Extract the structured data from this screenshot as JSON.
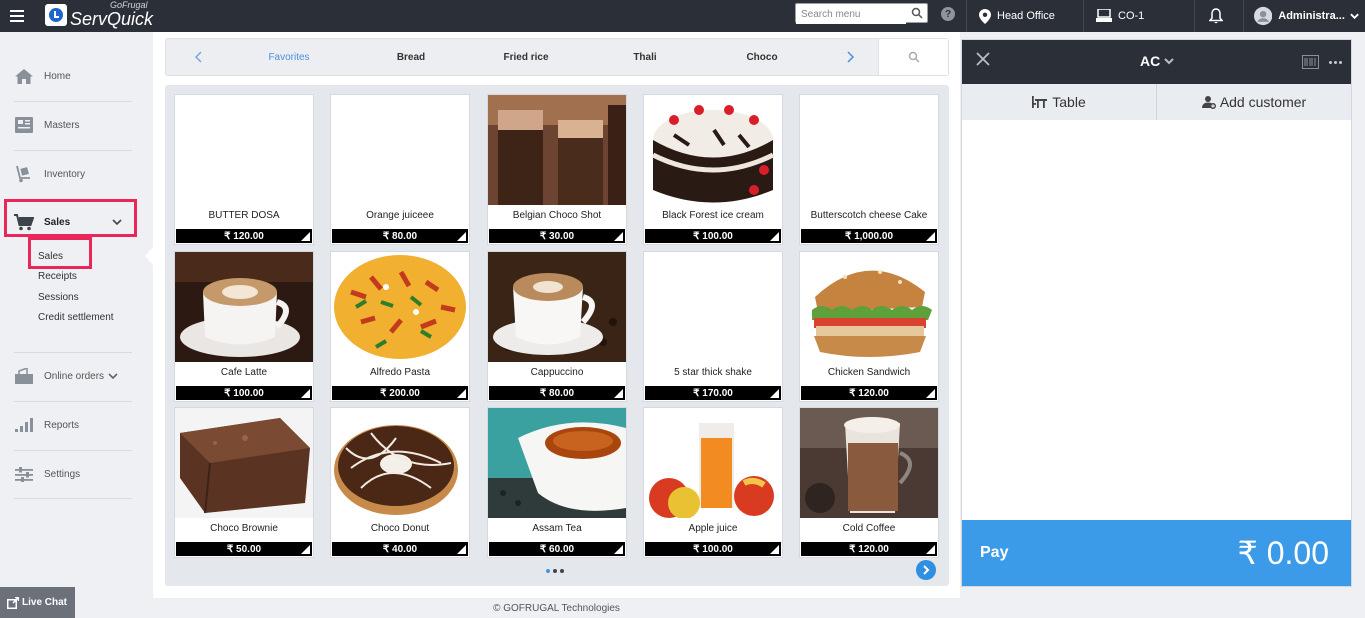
{
  "topbar": {
    "logo_small": "GoFrugal",
    "logo_big": "ServQuick",
    "search_placeholder": "Search menu",
    "location": "Head Office",
    "counter": "CO-1",
    "user": "Administra..."
  },
  "sidebar": {
    "items": [
      {
        "label": "Home",
        "icon": "home-icon"
      },
      {
        "label": "Masters",
        "icon": "masters-icon"
      },
      {
        "label": "Inventory",
        "icon": "inventory-icon"
      },
      {
        "label": "Sales",
        "icon": "cart-icon"
      },
      {
        "label": "Online orders",
        "icon": "online-orders-icon"
      },
      {
        "label": "Reports",
        "icon": "reports-icon"
      },
      {
        "label": "Settings",
        "icon": "settings-icon"
      }
    ],
    "sales_sub": [
      "Sales",
      "Receipts",
      "Sessions",
      "Credit settlement"
    ],
    "live_chat": "Live Chat"
  },
  "categories": [
    "Favorites",
    "Bread",
    "Fried rice",
    "Thali",
    "Choco"
  ],
  "items": [
    {
      "name": "BUTTER DOSA",
      "price": "₹ 120.00"
    },
    {
      "name": "Orange juiceee",
      "price": "₹ 80.00"
    },
    {
      "name": "Belgian Choco Shot",
      "price": "₹ 30.00"
    },
    {
      "name": "Black Forest ice cream",
      "price": "₹ 100.00"
    },
    {
      "name": "Butterscotch cheese Cake",
      "price": "₹ 1,000.00"
    },
    {
      "name": "Cafe Latte",
      "price": "₹ 100.00"
    },
    {
      "name": "Alfredo Pasta",
      "price": "₹ 200.00"
    },
    {
      "name": "Cappuccino",
      "price": "₹ 80.00"
    },
    {
      "name": "5 star thick shake",
      "price": "₹ 170.00"
    },
    {
      "name": "Chicken Sandwich",
      "price": "₹ 120.00"
    },
    {
      "name": "Choco Brownie",
      "price": "₹ 50.00"
    },
    {
      "name": "Choco Donut",
      "price": "₹ 40.00"
    },
    {
      "name": "Assam Tea",
      "price": "₹ 60.00"
    },
    {
      "name": "Apple juice",
      "price": "₹ 100.00"
    },
    {
      "name": "Cold Coffee",
      "price": "₹ 120.00"
    }
  ],
  "footer": "© GOFRUGAL Technologies",
  "order": {
    "mode": "AC",
    "table_label": "Table",
    "customer_label": "Add customer",
    "pay_label": "Pay",
    "total": "₹ 0.00"
  },
  "colors": {
    "accent": "#3b9be8",
    "header": "#2b3038",
    "highlight": "#e8285a"
  }
}
